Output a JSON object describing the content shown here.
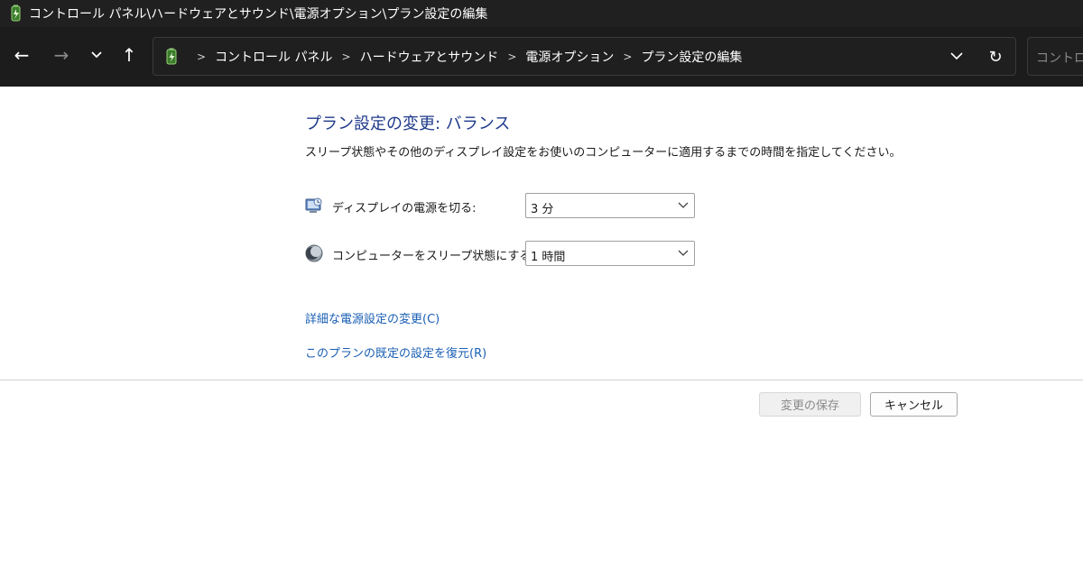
{
  "window": {
    "title": "コントロール パネル\\ハードウェアとサウンド\\電源オプション\\プラン設定の編集"
  },
  "nav": {
    "back_icon": "←",
    "forward_icon": "→",
    "up_icon": "↑",
    "refresh_icon": "↻"
  },
  "address": {
    "crumbs": [
      "コントロール パネル",
      "ハードウェアとサウンド",
      "電源オプション",
      "プラン設定の編集"
    ],
    "search_placeholder": "コントロール"
  },
  "content": {
    "heading": "プラン設定の変更: バランス",
    "subtitle": "スリープ状態やその他のディスプレイ設定をお使いのコンピューターに適用するまでの時間を指定してください。",
    "settings": [
      {
        "label": "ディスプレイの電源を切る:",
        "value": "3 分",
        "icon": "monitor-power-icon"
      },
      {
        "label": "コンピューターをスリープ状態にする:",
        "value": "1 時間",
        "icon": "sleep-moon-icon"
      }
    ],
    "links": {
      "advanced": "詳細な電源設定の変更(C)",
      "restore": "このプランの既定の設定を復元(R)"
    }
  },
  "buttons": {
    "save": "変更の保存",
    "cancel": "キャンセル"
  },
  "colors": {
    "heading": "#1e3a8a",
    "link": "#1a5fb4",
    "titlebar": "#202020",
    "navbar": "#1c1c1c"
  }
}
